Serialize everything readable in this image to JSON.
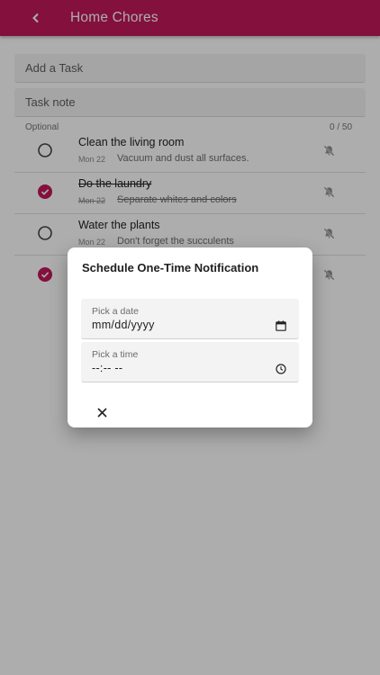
{
  "app_bar": {
    "title": "Home Chores",
    "back_icon": "back-arrow-icon",
    "color": "#c2185b"
  },
  "inputs": {
    "add_task_placeholder": "Add a Task",
    "task_note_placeholder": "Task note",
    "optional_label": "Optional",
    "char_counter": "0 / 50"
  },
  "tasks": [
    {
      "name": "Clean the living room",
      "date": "Mon 22",
      "note": "Vacuum and dust all surfaces.",
      "completed": false,
      "icon": "notifications-off-icon"
    },
    {
      "name": "Do the laundry",
      "date": "Mon 22",
      "note": "Separate whites and colors",
      "completed": true,
      "icon": "notifications-off-icon"
    },
    {
      "name": "Water the plants",
      "date": "Mon 22",
      "note": "Don't forget the succulents",
      "completed": false,
      "icon": "notifications-off-icon"
    },
    {
      "name": "",
      "date": "",
      "note": "",
      "completed": true,
      "icon": "notifications-off-icon"
    }
  ],
  "dialog": {
    "title": "Schedule One-Time Notification",
    "date_field": {
      "label": "Pick a date",
      "value": "mm/dd/yyyy",
      "icon": "calendar-icon"
    },
    "time_field": {
      "label": "Pick a time",
      "value": "--:-- --",
      "icon": "clock-icon"
    },
    "close_icon": "close-icon"
  },
  "colors": {
    "accent": "#c2185b",
    "scrim": "rgba(0,0,0,0.32)"
  }
}
